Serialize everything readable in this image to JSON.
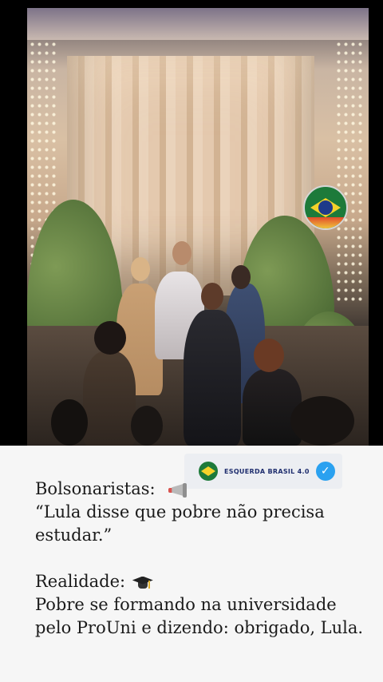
{
  "badge": {
    "name": "ESQUERDA BRASIL 4.0",
    "verified": true,
    "logo_icon": "brazil-flag-circle-icon",
    "verified_icon": "verified-check-icon"
  },
  "caption": {
    "line1": "Bolsonaristas:",
    "line1_icon": "megaphone-icon",
    "line2": "“Lula disse que pobre não precisa",
    "line3": "estudar.”",
    "line4": "Realidade:",
    "line4_icon": "graduation-cap-icon",
    "line5": "Pobre se formando na universidade",
    "line6": "pelo ProUni e dizendo: obrigado, Lula."
  },
  "video": {
    "overlay_icon": "brazil-flag-circle-icon"
  },
  "colors": {
    "caption_background": "#f6f6f6",
    "badge_background": "#eceef2",
    "badge_text": "#1f2e6e",
    "verified_blue": "#2aa1f0"
  }
}
